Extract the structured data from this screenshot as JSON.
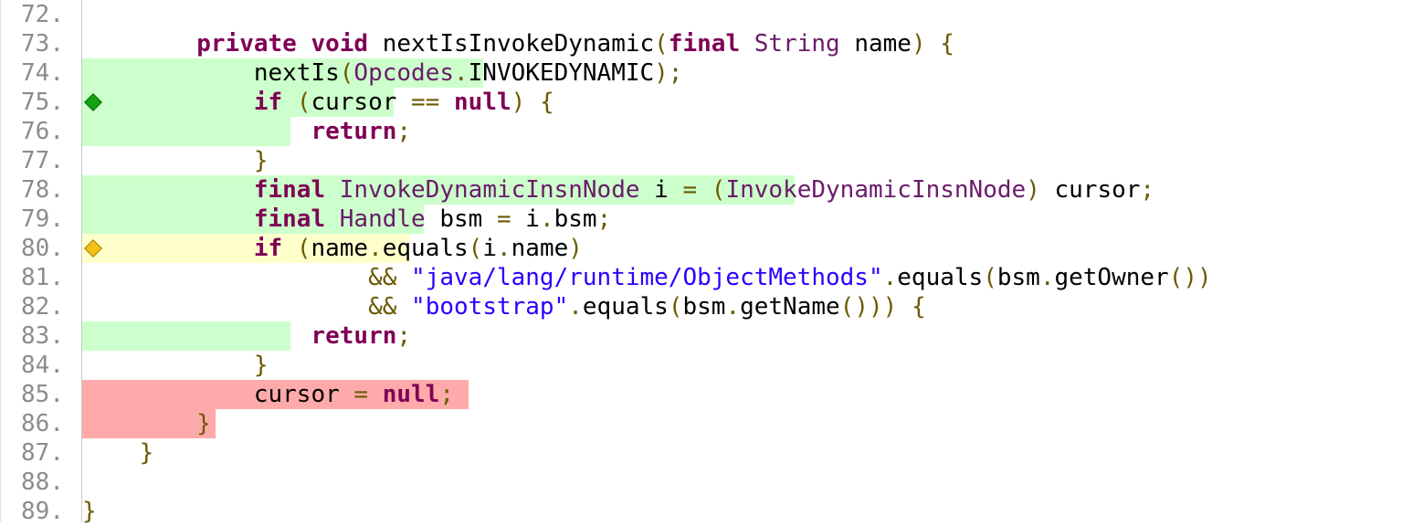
{
  "editor": {
    "colors": {
      "covered": "#ccffcc",
      "partial": "#ffffcc",
      "missed": "#ffaaaa",
      "keyword": "#7f0055",
      "type": "#6a1b6a",
      "string": "#2a00ff",
      "punctuation": "#6b5a00",
      "line_number": "#8c8c8c"
    },
    "lines": [
      {
        "number": "72.",
        "coverage": "",
        "marker": "",
        "tokens": []
      },
      {
        "number": "73.",
        "coverage": "",
        "marker": "",
        "tokens": [
          [
            "",
            "        "
          ],
          [
            "kw",
            "private"
          ],
          [
            "",
            " "
          ],
          [
            "kw",
            "void"
          ],
          [
            "",
            " nextIsInvokeDynamic"
          ],
          [
            "pn",
            "("
          ],
          [
            "kw",
            "final"
          ],
          [
            "",
            " "
          ],
          [
            "ty",
            "String"
          ],
          [
            "",
            " name"
          ],
          [
            "pn",
            ")"
          ],
          [
            "",
            " "
          ],
          [
            "pn",
            "{"
          ]
        ]
      },
      {
        "number": "74.",
        "coverage": "full",
        "hl_chars": 27,
        "marker": "",
        "tokens": [
          [
            "",
            "            nextIs"
          ],
          [
            "pn",
            "("
          ],
          [
            "ty",
            "Opcodes"
          ],
          [
            "pn",
            "."
          ],
          [
            "",
            "INVOKEDYNAMIC"
          ],
          [
            "pn",
            ");"
          ]
        ]
      },
      {
        "number": "75.",
        "coverage": "full",
        "hl_chars": 21,
        "marker": "green",
        "tokens": [
          [
            "",
            "            "
          ],
          [
            "kw",
            "if"
          ],
          [
            "",
            " "
          ],
          [
            "pn",
            "("
          ],
          [
            "",
            "cursor "
          ],
          [
            "pn",
            "=="
          ],
          [
            "",
            " "
          ],
          [
            "kw",
            "null"
          ],
          [
            "pn",
            ")"
          ],
          [
            "",
            " "
          ],
          [
            "pn",
            "{"
          ]
        ]
      },
      {
        "number": "76.",
        "coverage": "full",
        "hl_chars": 14,
        "marker": "",
        "tokens": [
          [
            "",
            "                "
          ],
          [
            "kw",
            "return"
          ],
          [
            "pn",
            ";"
          ]
        ]
      },
      {
        "number": "77.",
        "coverage": "",
        "marker": "",
        "tokens": [
          [
            "",
            "            "
          ],
          [
            "pn",
            "}"
          ]
        ]
      },
      {
        "number": "78.",
        "coverage": "full",
        "hl_chars": 48,
        "marker": "",
        "tokens": [
          [
            "",
            "            "
          ],
          [
            "kw",
            "final"
          ],
          [
            "",
            " "
          ],
          [
            "ty",
            "InvokeDynamicInsnNode"
          ],
          [
            "",
            " i "
          ],
          [
            "pn",
            "="
          ],
          [
            "",
            " "
          ],
          [
            "pn",
            "("
          ],
          [
            "ty",
            "InvokeDynamicInsnNode"
          ],
          [
            "pn",
            ")"
          ],
          [
            "",
            " cursor"
          ],
          [
            "pn",
            ";"
          ]
        ]
      },
      {
        "number": "79.",
        "coverage": "full",
        "hl_chars": 23,
        "marker": "",
        "tokens": [
          [
            "",
            "            "
          ],
          [
            "kw",
            "final"
          ],
          [
            "",
            " "
          ],
          [
            "ty",
            "Handle"
          ],
          [
            "",
            " bsm "
          ],
          [
            "pn",
            "="
          ],
          [
            "",
            " i"
          ],
          [
            "pn",
            "."
          ],
          [
            "",
            "bsm"
          ],
          [
            "pn",
            ";"
          ]
        ]
      },
      {
        "number": "80.",
        "coverage": "partial",
        "hl_chars": 22,
        "marker": "yellow",
        "tokens": [
          [
            "",
            "            "
          ],
          [
            "kw",
            "if"
          ],
          [
            "",
            " "
          ],
          [
            "pn",
            "("
          ],
          [
            "",
            "name"
          ],
          [
            "pn",
            "."
          ],
          [
            "",
            "equals"
          ],
          [
            "pn",
            "("
          ],
          [
            "",
            "i"
          ],
          [
            "pn",
            "."
          ],
          [
            "",
            "name"
          ],
          [
            "pn",
            ")"
          ]
        ]
      },
      {
        "number": "81.",
        "coverage": "",
        "marker": "",
        "tokens": [
          [
            "",
            "                    "
          ],
          [
            "pn",
            "&&"
          ],
          [
            "",
            " "
          ],
          [
            "st",
            "\"java/lang/runtime/ObjectMethods\""
          ],
          [
            "pn",
            "."
          ],
          [
            "",
            "equals"
          ],
          [
            "pn",
            "("
          ],
          [
            "",
            "bsm"
          ],
          [
            "pn",
            "."
          ],
          [
            "",
            "getOwner"
          ],
          [
            "pn",
            "())"
          ]
        ]
      },
      {
        "number": "82.",
        "coverage": "",
        "marker": "",
        "tokens": [
          [
            "",
            "                    "
          ],
          [
            "pn",
            "&&"
          ],
          [
            "",
            " "
          ],
          [
            "st",
            "\"bootstrap\""
          ],
          [
            "pn",
            "."
          ],
          [
            "",
            "equals"
          ],
          [
            "pn",
            "("
          ],
          [
            "",
            "bsm"
          ],
          [
            "pn",
            "."
          ],
          [
            "",
            "getName"
          ],
          [
            "pn",
            "()))"
          ],
          [
            "",
            " "
          ],
          [
            "pn",
            "{"
          ]
        ]
      },
      {
        "number": "83.",
        "coverage": "full",
        "hl_chars": 14,
        "marker": "",
        "tokens": [
          [
            "",
            "                "
          ],
          [
            "kw",
            "return"
          ],
          [
            "pn",
            ";"
          ]
        ]
      },
      {
        "number": "84.",
        "coverage": "",
        "marker": "",
        "tokens": [
          [
            "",
            "            "
          ],
          [
            "pn",
            "}"
          ]
        ]
      },
      {
        "number": "85.",
        "coverage": "none",
        "hl_chars": 26,
        "marker": "",
        "tokens": [
          [
            "",
            "            cursor "
          ],
          [
            "pn",
            "="
          ],
          [
            "",
            " "
          ],
          [
            "kw",
            "null"
          ],
          [
            "pn",
            ";"
          ]
        ]
      },
      {
        "number": "86.",
        "coverage": "none",
        "hl_chars": 9,
        "marker": "",
        "tokens": [
          [
            "",
            "        "
          ],
          [
            "pn",
            "}"
          ]
        ]
      },
      {
        "number": "87.",
        "coverage": "",
        "marker": "",
        "tokens": [
          [
            "",
            "    "
          ],
          [
            "pn",
            "}"
          ]
        ]
      },
      {
        "number": "88.",
        "coverage": "",
        "marker": "",
        "tokens": []
      },
      {
        "number": "89.",
        "coverage": "",
        "marker": "",
        "tokens": [
          [
            "pn",
            "}"
          ]
        ]
      }
    ]
  }
}
